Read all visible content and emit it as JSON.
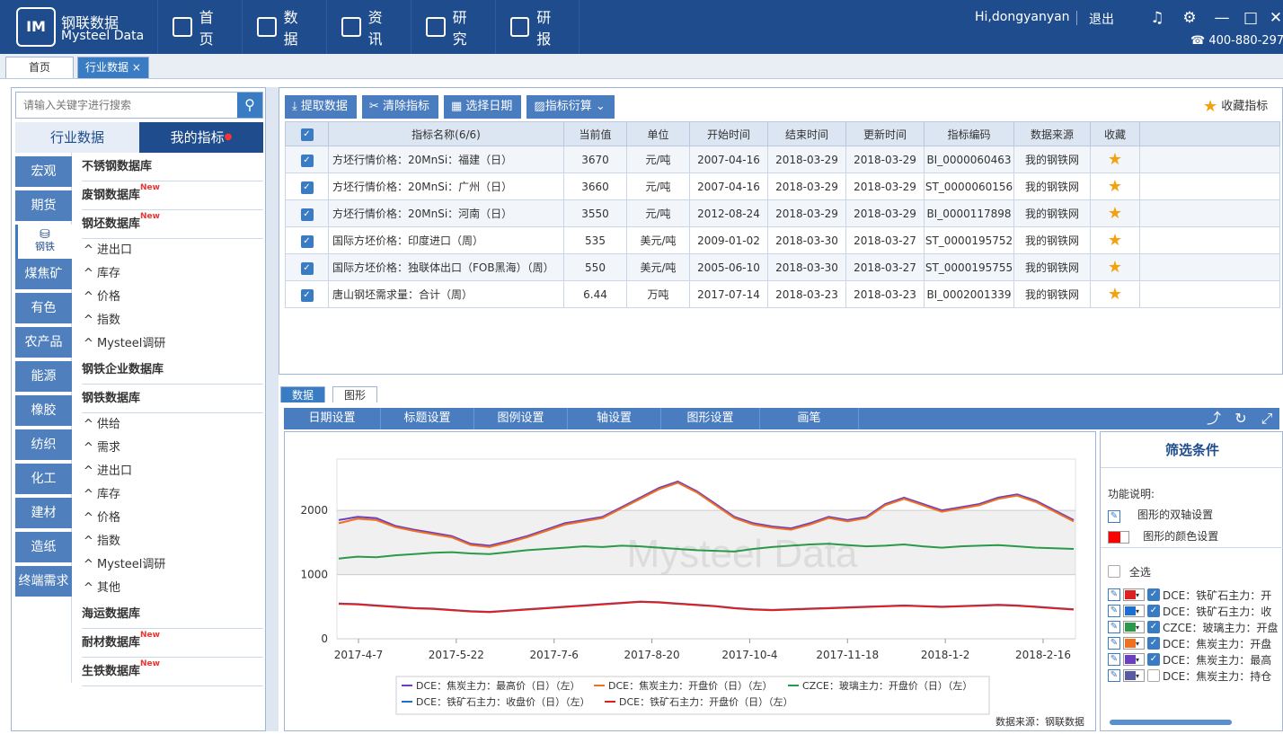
{
  "header": {
    "logo_cn": "钢联数据",
    "logo_en": "Mysteel Data",
    "nav": [
      {
        "label": "首页",
        "icon": "home-icon"
      },
      {
        "label": "数据",
        "icon": "chart-icon"
      },
      {
        "label": "资讯",
        "icon": "news-icon"
      },
      {
        "label": "研究",
        "icon": "layers-icon"
      },
      {
        "label": "研报",
        "icon": "report-icon"
      }
    ],
    "user": "Hi,dongyanyan",
    "logout": "退出",
    "phone": "400-880-297"
  },
  "tabs": [
    {
      "label": "首页"
    },
    {
      "label": "行业数据 ×"
    }
  ],
  "sidebar": {
    "search_placeholder": "请输入关键字进行搜索",
    "tab_industry": "行业数据",
    "tab_mine": "我的指标",
    "categories": [
      "宏观",
      "期货",
      "钢铁",
      "煤焦矿",
      "有色",
      "农产品",
      "能源",
      "橡胶",
      "纺织",
      "化工",
      "建材",
      "造纸",
      "终端需求"
    ],
    "tree": [
      {
        "type": "h",
        "label": "不锈钢数据库",
        "new": ""
      },
      {
        "type": "h",
        "label": "废钢数据库",
        "new": "New"
      },
      {
        "type": "h",
        "label": "钢坯数据库",
        "new": "New"
      },
      {
        "type": "i",
        "label": "^ 进出口"
      },
      {
        "type": "i",
        "label": "^ 库存"
      },
      {
        "type": "i",
        "label": "^ 价格"
      },
      {
        "type": "i",
        "label": "^ 指数"
      },
      {
        "type": "i",
        "label": "^ Mysteel调研"
      },
      {
        "type": "h",
        "label": "钢铁企业数据库",
        "new": ""
      },
      {
        "type": "h",
        "label": "钢铁数据库",
        "new": ""
      },
      {
        "type": "i",
        "label": "^ 供给"
      },
      {
        "type": "i",
        "label": "^ 需求"
      },
      {
        "type": "i",
        "label": "^ 进出口"
      },
      {
        "type": "i",
        "label": "^ 库存"
      },
      {
        "type": "i",
        "label": "^ 价格"
      },
      {
        "type": "i",
        "label": "^ 指数"
      },
      {
        "type": "i",
        "label": "^ Mysteel调研"
      },
      {
        "type": "i",
        "label": "^ 其他"
      },
      {
        "type": "h",
        "label": "海运数据库",
        "new": ""
      },
      {
        "type": "h",
        "label": "耐材数据库",
        "new": "New"
      },
      {
        "type": "h",
        "label": "生铁数据库",
        "new": "New"
      }
    ]
  },
  "toolbar": {
    "fetch": "提取数据",
    "clear": "清除指标",
    "date": "选择日期",
    "derive": "指标衍算",
    "favorite": "收藏指标"
  },
  "table": {
    "headers": [
      "指标名称(6/6)",
      "当前值",
      "单位",
      "开始时间",
      "结束时间",
      "更新时间",
      "指标编码",
      "数据来源",
      "收藏"
    ],
    "rows": [
      [
        "方坯行情价格：20MnSi：福建（日）",
        "3670",
        "元/吨",
        "2007-04-16",
        "2018-03-29",
        "2018-03-29",
        "BI_0000060463",
        "我的钢铁网"
      ],
      [
        "方坯行情价格：20MnSi：广州（日）",
        "3660",
        "元/吨",
        "2007-04-16",
        "2018-03-29",
        "2018-03-29",
        "ST_0000060156",
        "我的钢铁网"
      ],
      [
        "方坯行情价格：20MnSi：河南（日）",
        "3550",
        "元/吨",
        "2012-08-24",
        "2018-03-29",
        "2018-03-29",
        "BI_0000117898",
        "我的钢铁网"
      ],
      [
        "国际方坯价格：印度进口（周）",
        "535",
        "美元/吨",
        "2009-01-02",
        "2018-03-30",
        "2018-03-27",
        "ST_0000195752",
        "我的钢铁网"
      ],
      [
        "国际方坯价格：独联体出口（FOB黑海）（周）",
        "550",
        "美元/吨",
        "2005-06-10",
        "2018-03-30",
        "2018-03-27",
        "ST_0000195755",
        "我的钢铁网"
      ],
      [
        "唐山钢坯需求量：合计（周）",
        "6.44",
        "万吨",
        "2017-07-14",
        "2018-03-23",
        "2018-03-23",
        "BI_0002001339",
        "我的钢铁网"
      ]
    ]
  },
  "lower_tabs": [
    "数据",
    "图形"
  ],
  "chart_menu": [
    "日期设置",
    "标题设置",
    "图例设置",
    "轴设置",
    "图形设置",
    "画笔"
  ],
  "chart_data": {
    "type": "line",
    "x_ticks": [
      "2017-4-7",
      "2017-5-22",
      "2017-7-6",
      "2017-8-20",
      "2017-10-4",
      "2017-11-18",
      "2018-1-2",
      "2018-2-16"
    ],
    "y_ticks": [
      "0",
      "1000",
      "2000"
    ],
    "ylim": [
      0,
      2800
    ],
    "watermark": "Mysteel Data",
    "source": "数据来源：钢联数据",
    "series": [
      {
        "name": "DCE：焦炭主力：最高价（日）（左）",
        "color": "#6a3fc4",
        "values": [
          1850,
          1900,
          1880,
          1760,
          1700,
          1650,
          1600,
          1480,
          1450,
          1520,
          1600,
          1700,
          1800,
          1850,
          1900,
          2050,
          2200,
          2350,
          2450,
          2300,
          2100,
          1900,
          1800,
          1750,
          1720,
          1800,
          1900,
          1850,
          1900,
          2100,
          2200,
          2100,
          2000,
          2050,
          2100,
          2200,
          2250,
          2150,
          2000,
          1850
        ]
      },
      {
        "name": "DCE：焦炭主力：开盘价（日）（左）",
        "color": "#f07020",
        "values": [
          1800,
          1870,
          1850,
          1740,
          1680,
          1630,
          1580,
          1460,
          1430,
          1500,
          1580,
          1680,
          1780,
          1830,
          1880,
          2030,
          2180,
          2330,
          2430,
          2280,
          2080,
          1880,
          1780,
          1730,
          1700,
          1780,
          1880,
          1830,
          1880,
          2080,
          2180,
          2080,
          1980,
          2030,
          2080,
          2180,
          2230,
          2130,
          1980,
          1830
        ]
      },
      {
        "name": "CZCE：玻璃主力：开盘价（日）（左）",
        "color": "#2a9a48",
        "values": [
          1250,
          1280,
          1270,
          1300,
          1320,
          1340,
          1350,
          1330,
          1320,
          1350,
          1380,
          1400,
          1420,
          1440,
          1430,
          1450,
          1440,
          1420,
          1400,
          1380,
          1370,
          1360,
          1400,
          1430,
          1450,
          1470,
          1480,
          1460,
          1440,
          1450,
          1470,
          1440,
          1420,
          1440,
          1450,
          1460,
          1440,
          1420,
          1410,
          1400
        ]
      },
      {
        "name": "DCE：铁矿石主力：收盘价（日）（左）",
        "color": "#1a6fd0",
        "values": [
          550,
          540,
          520,
          500,
          480,
          470,
          450,
          430,
          420,
          440,
          460,
          480,
          500,
          520,
          540,
          560,
          580,
          570,
          550,
          530,
          510,
          480,
          460,
          450,
          460,
          470,
          480,
          490,
          500,
          510,
          520,
          510,
          500,
          510,
          520,
          530,
          520,
          500,
          480,
          460
        ]
      },
      {
        "name": "DCE：铁矿石主力：开盘价（日）（左）",
        "color": "#e02020",
        "values": [
          545,
          535,
          515,
          495,
          475,
          465,
          445,
          425,
          415,
          435,
          455,
          475,
          495,
          515,
          535,
          555,
          575,
          565,
          545,
          525,
          505,
          475,
          455,
          445,
          455,
          465,
          475,
          485,
          495,
          505,
          515,
          505,
          495,
          505,
          515,
          525,
          515,
          495,
          475,
          455
        ]
      }
    ]
  },
  "filter": {
    "title": "筛选条件",
    "desc": "功能说明:",
    "dual_axis": "图形的双轴设置",
    "color_setting": "图形的颜色设置",
    "select_all": "全选",
    "items": [
      {
        "label": "DCE：铁矿石主力：开",
        "color": "#e02020",
        "checked": true
      },
      {
        "label": "DCE：铁矿石主力：收",
        "color": "#1a6fd0",
        "checked": true
      },
      {
        "label": "CZCE：玻璃主力：开盘",
        "color": "#2a9a48",
        "checked": true
      },
      {
        "label": "DCE：焦炭主力：开盘",
        "color": "#f07020",
        "checked": true
      },
      {
        "label": "DCE：焦炭主力：最高",
        "color": "#6a3fc4",
        "checked": true
      },
      {
        "label": "DCE：焦炭主力：持仓",
        "color": "#5a5aa0",
        "checked": false
      }
    ]
  }
}
